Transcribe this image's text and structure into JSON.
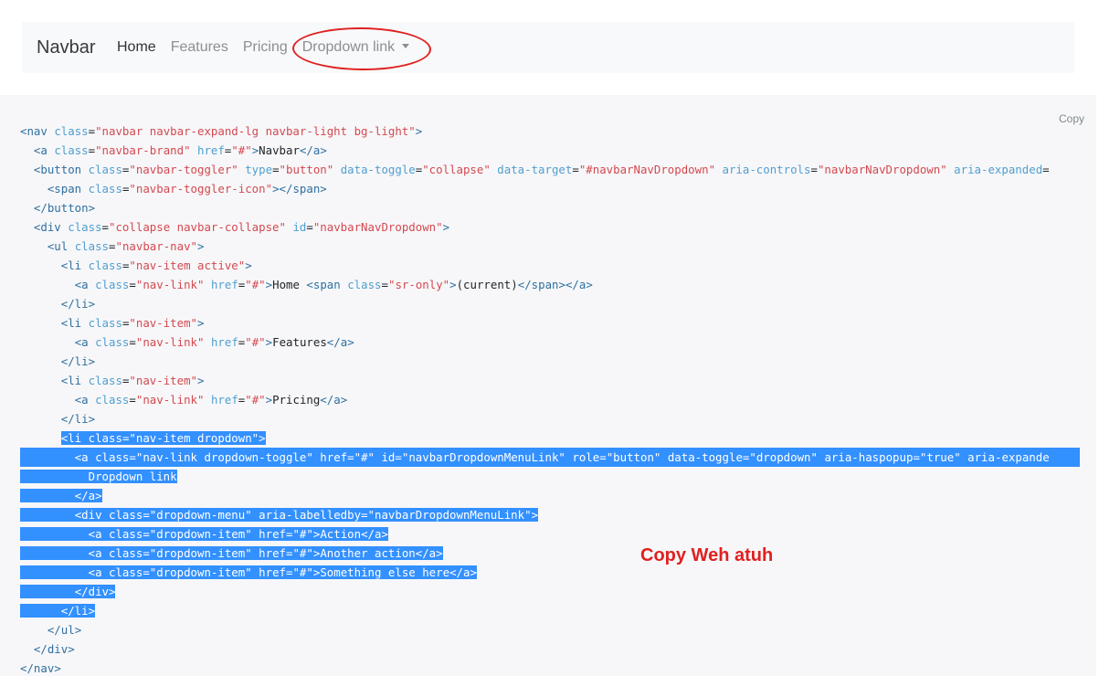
{
  "navbar": {
    "brand": "Navbar",
    "links": [
      {
        "label": "Home",
        "active": true
      },
      {
        "label": "Features",
        "active": false
      },
      {
        "label": "Pricing",
        "active": false
      }
    ],
    "dropdown_label": "Dropdown link",
    "dropdown_icon": "caret-down-icon"
  },
  "code_block": {
    "copy_label": "Copy",
    "lines": [
      "<nav class=\"navbar navbar-expand-lg navbar-light bg-light\">",
      "  <a class=\"navbar-brand\" href=\"#\">Navbar</a>",
      "  <button class=\"navbar-toggler\" type=\"button\" data-toggle=\"collapse\" data-target=\"#navbarNavDropdown\" aria-controls=\"navbarNavDropdown\" aria-expanded=",
      "    <span class=\"navbar-toggler-icon\"></span>",
      "  </button>",
      "  <div class=\"collapse navbar-collapse\" id=\"navbarNavDropdown\">",
      "    <ul class=\"navbar-nav\">",
      "      <li class=\"nav-item active\">",
      "        <a class=\"nav-link\" href=\"#\">Home <span class=\"sr-only\">(current)</span></a>",
      "      </li>",
      "      <li class=\"nav-item\">",
      "        <a class=\"nav-link\" href=\"#\">Features</a>",
      "      </li>",
      "      <li class=\"nav-item\">",
      "        <a class=\"nav-link\" href=\"#\">Pricing</a>",
      "      </li>",
      "      <li class=\"nav-item dropdown\">",
      "        <a class=\"nav-link dropdown-toggle\" href=\"#\" id=\"navbarDropdownMenuLink\" role=\"button\" data-toggle=\"dropdown\" aria-haspopup=\"true\" aria-expande",
      "          Dropdown link",
      "        </a>",
      "        <div class=\"dropdown-menu\" aria-labelledby=\"navbarDropdownMenuLink\">",
      "          <a class=\"dropdown-item\" href=\"#\">Action</a>",
      "          <a class=\"dropdown-item\" href=\"#\">Another action</a>",
      "          <a class=\"dropdown-item\" href=\"#\">Something else here</a>",
      "        </div>",
      "      </li>",
      "    </ul>",
      "  </div>",
      "</nav>"
    ],
    "selected_line_indices": [
      16,
      17,
      18,
      19,
      20,
      21,
      22,
      23,
      24,
      25
    ]
  },
  "annotation": {
    "text": "Copy Weh atuh",
    "color": "#e02020"
  },
  "colors": {
    "selection": "#3390ff",
    "tag": "#2f6f9f",
    "attribute": "#4f9fcf",
    "value": "#d44950",
    "code_background": "#f7f7f9",
    "navbar_background": "#f8f9fa"
  }
}
